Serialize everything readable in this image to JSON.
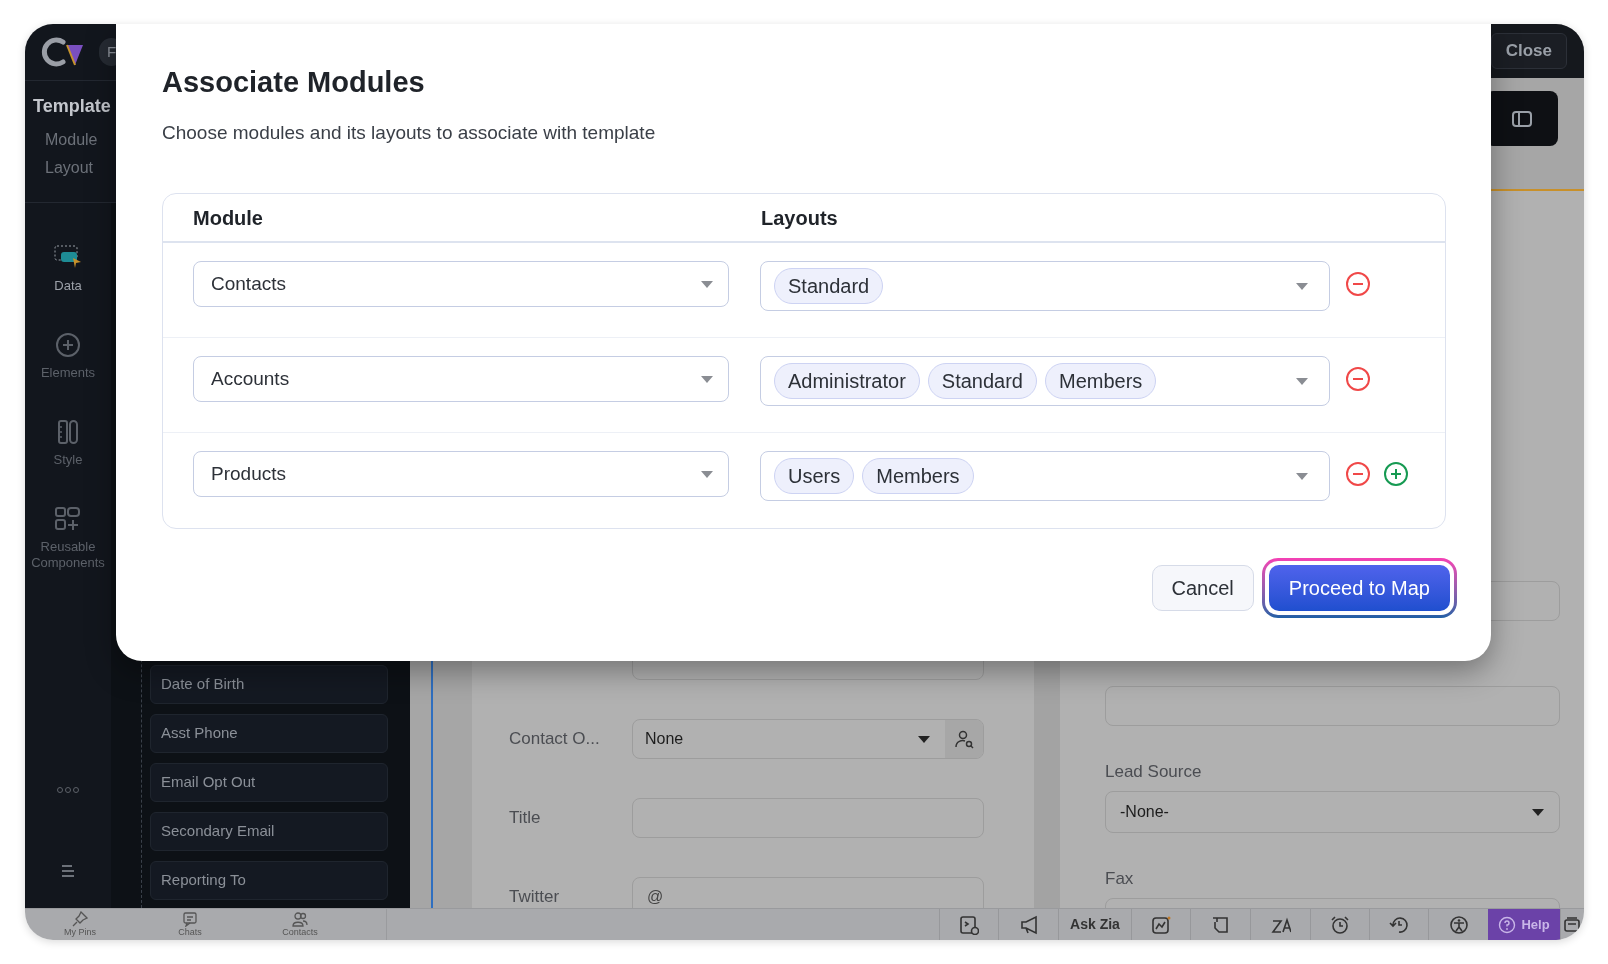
{
  "sidebar": {
    "logo_badge": "F",
    "section_title": "Template",
    "meta": [
      "Module",
      "Layout"
    ],
    "nav": [
      {
        "label": "Data",
        "kind": "data",
        "selected": true
      },
      {
        "label": "Elements",
        "kind": "elements",
        "selected": false
      },
      {
        "label": "Style",
        "kind": "style",
        "selected": false
      },
      {
        "label": "Reusable Components",
        "kind": "components",
        "selected": false
      }
    ]
  },
  "fields_panel": {
    "items": [
      "Date of Birth",
      "Asst Phone",
      "Email Opt Out",
      "Secondary Email",
      "Reporting To"
    ]
  },
  "header": {
    "close_button": "Close"
  },
  "form": {
    "left_fields": [
      {
        "kind": "text"
      },
      {
        "label": "Contact O...",
        "kind": "lookup",
        "value": "None"
      },
      {
        "label": "Title",
        "kind": "text"
      },
      {
        "label": "Twitter",
        "kind": "text",
        "prefix": "@"
      }
    ],
    "right_fields": [
      {
        "kind": "text"
      },
      {
        "kind": "text"
      },
      {
        "label": "Lead Source",
        "kind": "select",
        "value": "-None-"
      },
      {
        "label": "Fax",
        "kind": "text"
      }
    ]
  },
  "bottom_bar": {
    "shortcuts": [
      "My Pins",
      "Chats",
      "Contacts"
    ],
    "ask_zia": "Ask Zia",
    "help": "Help"
  },
  "dialog": {
    "title": "Associate Modules",
    "subtitle": "Choose modules and its layouts to associate with template",
    "columns": [
      "Module",
      "Layouts"
    ],
    "rows": [
      {
        "module": "Contacts",
        "layouts": [
          "Standard"
        ],
        "can_add": false
      },
      {
        "module": "Accounts",
        "layouts": [
          "Administrator",
          "Standard",
          "Members"
        ],
        "can_add": false
      },
      {
        "module": "Products",
        "layouts": [
          "Users",
          "Members"
        ],
        "can_add": true
      }
    ],
    "buttons": [
      {
        "label": "Cancel",
        "kind": "secondary",
        "focused": false
      },
      {
        "label": "Proceed to Map",
        "kind": "primary",
        "focused": true
      }
    ]
  }
}
